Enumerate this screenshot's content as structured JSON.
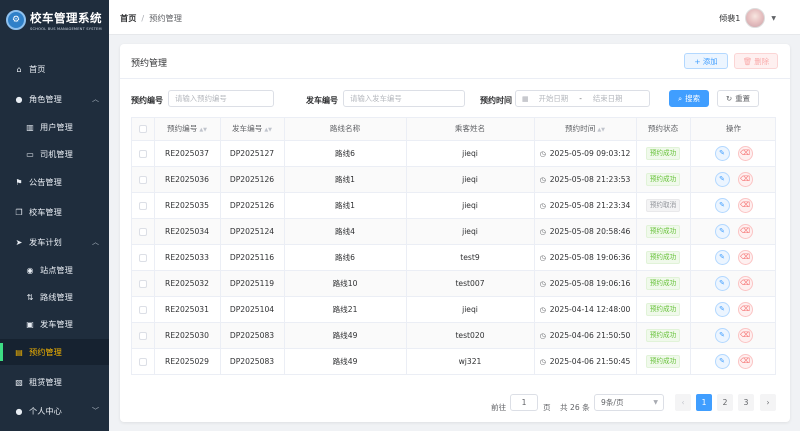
{
  "app": {
    "logo_text": "校车管理系统",
    "logo_subtitle": "SCHOOL BUS MANAGEMENT SYSTEM",
    "logo_icon": "bus-logo-icon"
  },
  "sidebar": {
    "items": [
      {
        "label": "首页",
        "icon": "home-icon"
      },
      {
        "label": "角色管理",
        "icon": "user-icon",
        "expanded": true
      },
      {
        "label": "用户管理",
        "icon": "table-icon"
      },
      {
        "label": "司机管理",
        "icon": "folder-icon"
      },
      {
        "label": "公告管理",
        "icon": "flag-icon"
      },
      {
        "label": "校车管理",
        "icon": "copy-icon"
      },
      {
        "label": "发车计划",
        "icon": "send-icon",
        "expanded": true
      },
      {
        "label": "站点管理",
        "icon": "location-icon"
      },
      {
        "label": "路线管理",
        "icon": "route-icon"
      },
      {
        "label": "发车管理",
        "icon": "truck-icon"
      },
      {
        "label": "预约管理",
        "icon": "document-icon",
        "active": true
      },
      {
        "label": "租赁管理",
        "icon": "picture-icon"
      },
      {
        "label": "个人中心",
        "icon": "user-icon"
      }
    ]
  },
  "header": {
    "breadcrumb_home": "首页",
    "breadcrumb_separator": "/",
    "breadcrumb_current": "预约管理",
    "user_name": "倾裴1"
  },
  "card": {
    "title": "预约管理",
    "add_label": "+ 添加",
    "delete_label": "删除"
  },
  "filters": {
    "reservation_no_label": "预约编号",
    "reservation_no_placeholder": "请输入预约编号",
    "departure_no_label": "发车编号",
    "departure_no_placeholder": "请输入发车编号",
    "time_label": "预约时间",
    "start_placeholder": "开始日期",
    "range_separator": "-",
    "end_placeholder": "结束日期",
    "search_label": "搜索",
    "reset_label": "重置"
  },
  "table": {
    "columns": [
      "预约编号",
      "发车编号",
      "路线名称",
      "乘客姓名",
      "预约时间",
      "预约状态",
      "操作"
    ],
    "rows": [
      {
        "reservation_no": "RE2025037",
        "departure_no": "DP2025127",
        "route": "路线6",
        "passenger": "jieqi",
        "time": "2025-05-09 09:03:12",
        "status": "预约成功",
        "status_type": "ok"
      },
      {
        "reservation_no": "RE2025036",
        "departure_no": "DP2025126",
        "route": "路线1",
        "passenger": "jieqi",
        "time": "2025-05-08 21:23:53",
        "status": "预约成功",
        "status_type": "ok"
      },
      {
        "reservation_no": "RE2025035",
        "departure_no": "DP2025126",
        "route": "路线1",
        "passenger": "jieqi",
        "time": "2025-05-08 21:23:34",
        "status": "预约取消",
        "status_type": "cancel"
      },
      {
        "reservation_no": "RE2025034",
        "departure_no": "DP2025124",
        "route": "路线4",
        "passenger": "jieqi",
        "time": "2025-05-08 20:58:46",
        "status": "预约成功",
        "status_type": "ok"
      },
      {
        "reservation_no": "RE2025033",
        "departure_no": "DP2025116",
        "route": "路线6",
        "passenger": "test9",
        "time": "2025-05-08 19:06:36",
        "status": "预约成功",
        "status_type": "ok"
      },
      {
        "reservation_no": "RE2025032",
        "departure_no": "DP2025119",
        "route": "路线10",
        "passenger": "test007",
        "time": "2025-05-08 19:06:16",
        "status": "预约成功",
        "status_type": "ok"
      },
      {
        "reservation_no": "RE2025031",
        "departure_no": "DP2025104",
        "route": "路线21",
        "passenger": "jieqi",
        "time": "2025-04-14 12:48:00",
        "status": "预约成功",
        "status_type": "ok"
      },
      {
        "reservation_no": "RE2025030",
        "departure_no": "DP2025083",
        "route": "路线49",
        "passenger": "test020",
        "time": "2025-04-06 21:50:50",
        "status": "预约成功",
        "status_type": "ok"
      },
      {
        "reservation_no": "RE2025029",
        "departure_no": "DP2025083",
        "route": "路线49",
        "passenger": "wj321",
        "time": "2025-04-06 21:50:45",
        "status": "预约成功",
        "status_type": "ok"
      }
    ]
  },
  "pagination": {
    "goto_label": "前往",
    "goto_value": "1",
    "page_unit": "页",
    "total_text": "共 26 条",
    "page_size": "9条/页",
    "pages": [
      "1",
      "2",
      "3"
    ],
    "current_page": "1",
    "prev_icon": "chevron-left-icon",
    "next_icon": "chevron-right-icon"
  },
  "colors": {
    "sidebar_bg": "#1f2d3d",
    "active_menu": "#f4b400",
    "primary": "#409eff",
    "success": "#67c23a",
    "danger": "#f56c6c"
  }
}
